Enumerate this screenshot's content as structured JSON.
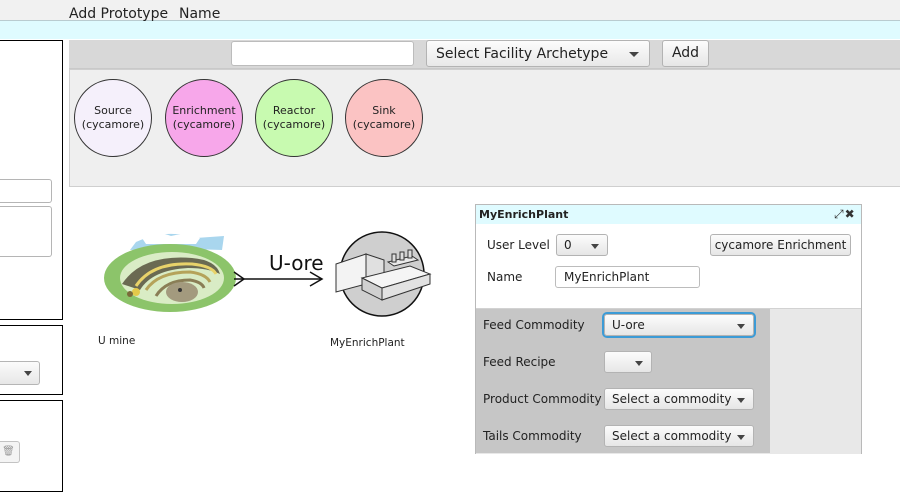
{
  "toolbar": {
    "add_prototype_label": "Add Prototype",
    "name_label": "Name",
    "name_value": "",
    "archetype_select": "Select Facility Archetype",
    "add_button": "Add"
  },
  "prototypes": [
    {
      "name": "Source",
      "lib": "(cycamore)",
      "color": "#f5f0fb"
    },
    {
      "name": "Enrichment",
      "lib": "(cycamore)",
      "color": "#f7a7ea"
    },
    {
      "name": "Reactor",
      "lib": "(cycamore)",
      "color": "#c8fab0"
    },
    {
      "name": "Sink",
      "lib": "(cycamore)",
      "color": "#fbc3c3"
    }
  ],
  "canvas": {
    "nodes": [
      {
        "label": "U mine",
        "icon": "mine-icon"
      },
      {
        "label": "MyEnrichPlant",
        "icon": "enrichment-facility-icon"
      }
    ],
    "arc_label": "U-ore"
  },
  "facility_window": {
    "title": "MyEnrichPlant",
    "user_level_label": "User Level",
    "user_level_value": "0",
    "archetype_button": "cycamore Enrichment",
    "name_label": "Name",
    "name_value": "MyEnrichPlant",
    "params": [
      {
        "label": "Feed Commodity",
        "value": "U-ore"
      },
      {
        "label": "Feed Recipe",
        "value": ""
      },
      {
        "label": "Product Commodity",
        "value": "Select a commodity"
      },
      {
        "label": "Tails Commodity",
        "value": "Select a commodity"
      }
    ]
  },
  "left_panel": {
    "trash_icon": "trash-icon"
  },
  "colors": {
    "accent_cyan": "#dffbff",
    "focus_blue": "#3c9bd6",
    "param_gray": "#c6c6c6"
  }
}
